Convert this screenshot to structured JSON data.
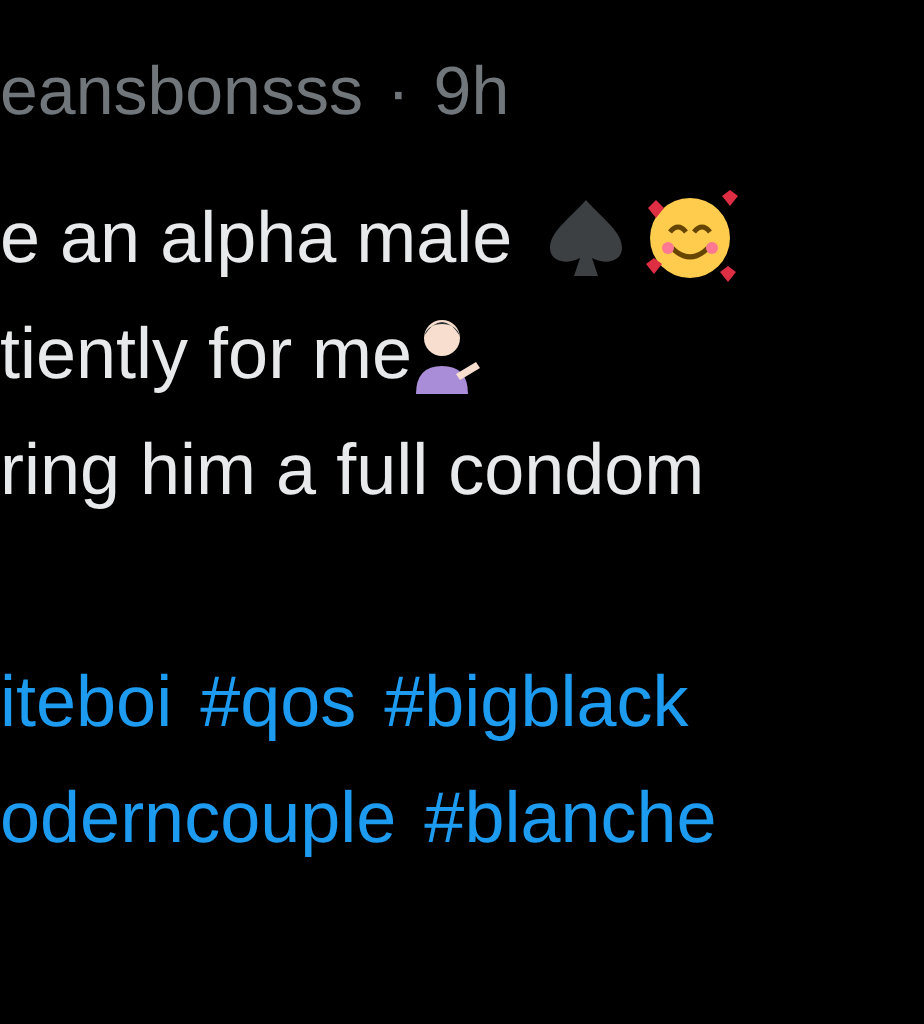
{
  "header": {
    "author": "eansbonsss",
    "separator": "·",
    "time": "9h"
  },
  "lines": [
    {
      "kind": "text",
      "segments": [
        {
          "kind": "text",
          "text": "e an alpha male"
        },
        {
          "kind": "spade"
        },
        {
          "kind": "smile"
        }
      ]
    },
    {
      "kind": "text",
      "segments": [
        {
          "kind": "text",
          "text": "tiently for me"
        },
        {
          "kind": "person"
        }
      ]
    },
    {
      "kind": "text",
      "segments": [
        {
          "kind": "text",
          "text": "ring him a full condom"
        }
      ]
    },
    {
      "kind": "blank"
    },
    {
      "kind": "text",
      "segments": [
        {
          "kind": "hashtag",
          "text": "iteboi"
        },
        {
          "kind": "hashtag",
          "text": "#qos"
        },
        {
          "kind": "hashtag",
          "text": "#bigblack"
        }
      ]
    },
    {
      "kind": "text",
      "segments": [
        {
          "kind": "hashtag",
          "text": "oderncouple"
        },
        {
          "kind": "hashtag",
          "text": "#blanche"
        }
      ]
    }
  ]
}
